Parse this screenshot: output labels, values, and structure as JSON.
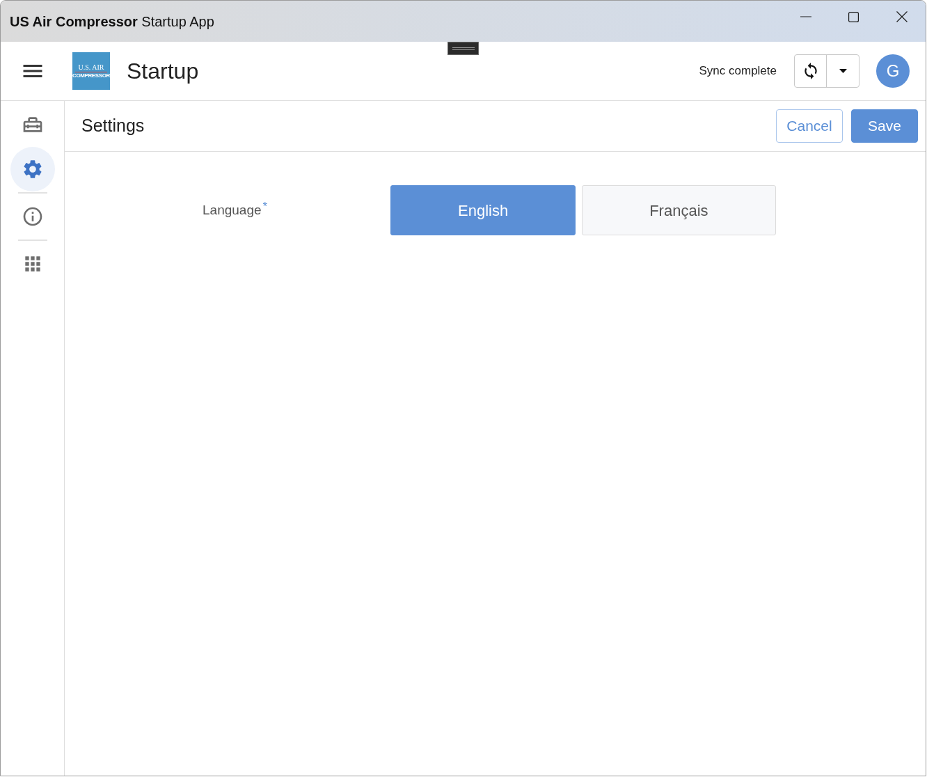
{
  "window": {
    "title": "**US Air Compressor** Startup App"
  },
  "header": {
    "logo": {
      "line_1": "U.S. AIR",
      "line_2": "COMPRESSOR"
    },
    "title": "Startup",
    "sync_status": "Sync complete",
    "avatar_initial": "G"
  },
  "sidebar": {
    "groups": [
      {
        "items": [
          {
            "selected": false
          },
          {
            "selected": true
          }
        ]
      },
      {
        "items": [
          {
            "selected": false
          }
        ]
      },
      {
        "items": [
          {
            "selected": false
          }
        ]
      }
    ]
  },
  "page": {
    "title": "Settings",
    "actions": [
      {
        "label": "Cancel",
        "kind": "secondary"
      },
      {
        "label": "Save",
        "kind": "primary"
      }
    ]
  },
  "form": {
    "fields": [
      {
        "label": "Language",
        "required": true,
        "required_mark": "*",
        "options": [
          {
            "label": "English",
            "selected": true
          },
          {
            "label": "Français",
            "selected": false
          }
        ]
      }
    ]
  }
}
